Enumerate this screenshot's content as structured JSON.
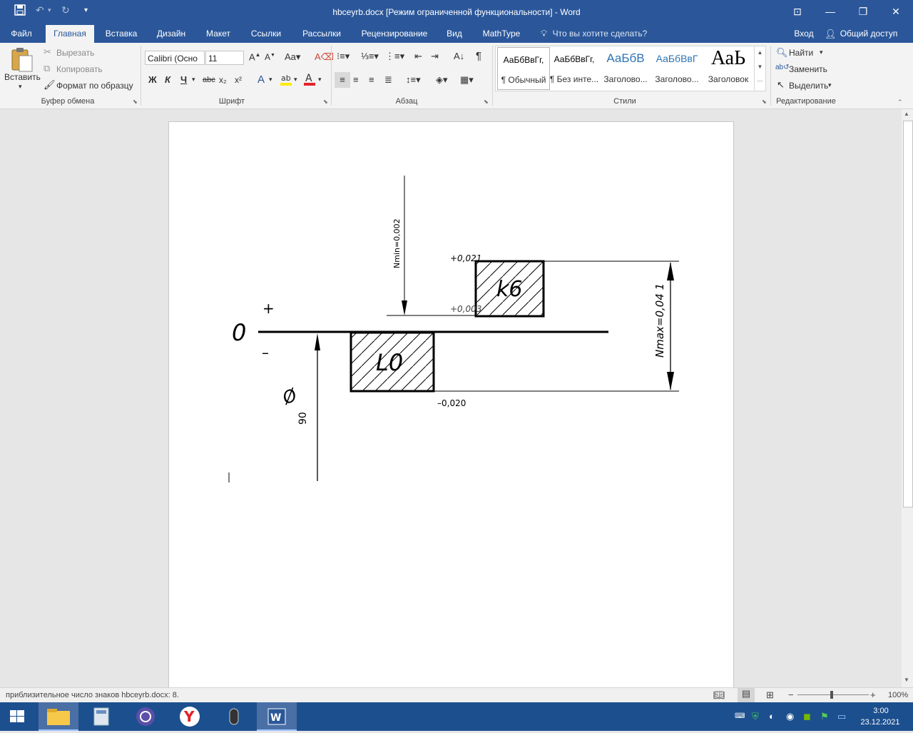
{
  "window": {
    "title": "hbceyrb.docx [Режим ограниченной функциональности] - Word",
    "accent": "#2b579a"
  },
  "quick_access": {
    "save_icon": "save-icon",
    "undo_icon": "undo-icon",
    "redo_icon": "redo-icon"
  },
  "tabs": [
    {
      "label": "Файл"
    },
    {
      "label": "Главная"
    },
    {
      "label": "Вставка"
    },
    {
      "label": "Дизайн"
    },
    {
      "label": "Макет"
    },
    {
      "label": "Ссылки"
    },
    {
      "label": "Рассылки"
    },
    {
      "label": "Рецензирование"
    },
    {
      "label": "Вид"
    },
    {
      "label": "MathType"
    },
    {
      "label": "Что вы хотите сделать?"
    }
  ],
  "account": {
    "login": "Вход",
    "share": "Общий доступ"
  },
  "clipboard": {
    "paste": "Вставить",
    "cut": "Вырезать",
    "copy": "Копировать",
    "format_painter": "Формат по образцу",
    "group_label": "Буфер обмена"
  },
  "font": {
    "family": "Calibri (Осно",
    "size": "11",
    "group_label": "Шрифт",
    "bold": "Ж",
    "italic": "К",
    "underline": "Ч",
    "strike": "abc",
    "subscript": "x₂",
    "superscript": "x²"
  },
  "paragraph": {
    "group_label": "Абзац"
  },
  "styles": {
    "group_label": "Стили",
    "items": [
      {
        "preview": "АаБбВвГг,",
        "name": "¶ Обычный"
      },
      {
        "preview": "АаБбВвГг,",
        "name": "¶ Без инте..."
      },
      {
        "preview": "АаБбВ",
        "name": "Заголово..."
      },
      {
        "preview": "АаБбВвГ",
        "name": "Заголово..."
      },
      {
        "preview": "АаЬ",
        "name": "Заголовок"
      }
    ]
  },
  "editing": {
    "find": "Найти",
    "replace": "Заменить",
    "select": "Выделить",
    "group_label": "Редактирование"
  },
  "drawing": {
    "nmin": "Nmin=0,002",
    "nmax": "Nmax=0,04 1",
    "upper_shaft_top": "+0,021",
    "upper_shaft_bottom": "+0,003",
    "lower_hole": "–0,020",
    "shaft_field": "k6",
    "hole_field": "L0",
    "zero": "0",
    "plus": "+",
    "minus": "–",
    "diameter_symbol": "Ø",
    "diameter_value": "90"
  },
  "status": {
    "words": "приблизительное число знаков hbceyrb.docx: 8.",
    "zoom": "100%"
  },
  "clock": {
    "time": "3:00",
    "date": "23.12.2021"
  }
}
